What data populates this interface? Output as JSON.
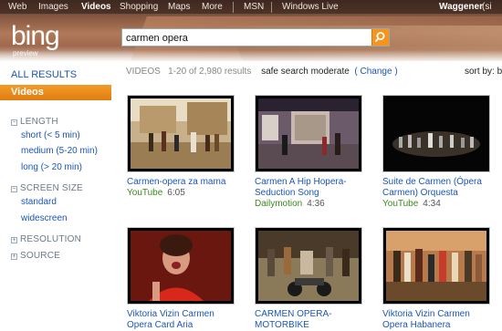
{
  "topnav": {
    "items": [
      "Web",
      "Images",
      "Videos",
      "Shopping",
      "Maps",
      "More",
      "MSN",
      "Windows Live"
    ],
    "active": "Videos",
    "user": "Waggener",
    "sign": "(si"
  },
  "logo": {
    "text": "bing",
    "sub": "preview"
  },
  "search": {
    "query": "carmen opera"
  },
  "sidebar": {
    "all_results": "ALL RESULTS",
    "videos": "Videos",
    "length": {
      "label": "LENGTH",
      "items": [
        "short (< 5 min)",
        "medium (5-20 min)",
        "long (> 20 min)"
      ]
    },
    "screen_size": {
      "label": "SCREEN SIZE",
      "items": [
        "standard",
        "widescreen"
      ]
    },
    "resolution": "RESOLUTION",
    "source": "SOURCE"
  },
  "info": {
    "label": "VIDEOS",
    "count": "1-20 of 2,980 results",
    "safe": "safe search moderate",
    "change_open": "(",
    "change": "Change",
    "change_close": ")",
    "sort": "sort by: be"
  },
  "videos": [
    {
      "title": [
        "Carmen-opera za mama"
      ],
      "source": "YouTube",
      "duration": "6:05"
    },
    {
      "title": [
        "Carmen A Hip Hopera-",
        "Seduction Song"
      ],
      "source": "Dailymotion",
      "duration": "4:36"
    },
    {
      "title": [
        "Suite de Carmen (Ópera",
        "Carmen) Orquesta"
      ],
      "source": "YouTube",
      "duration": "4:34"
    },
    {
      "title": [
        "Viktoria Vizin Carmen",
        "Opera Card Aria"
      ],
      "source": "",
      "duration": ""
    },
    {
      "title": [
        "CARMEN OPERA-",
        "MOTORBIKE"
      ],
      "source": "",
      "duration": ""
    },
    {
      "title": [
        "Viktoria Vizin Carmen",
        "Opera Habanera"
      ],
      "source": "",
      "duration": ""
    }
  ],
  "colors": {
    "accent": "#f7941e",
    "link": "#1a56b8",
    "source": "#3b8a1f"
  }
}
